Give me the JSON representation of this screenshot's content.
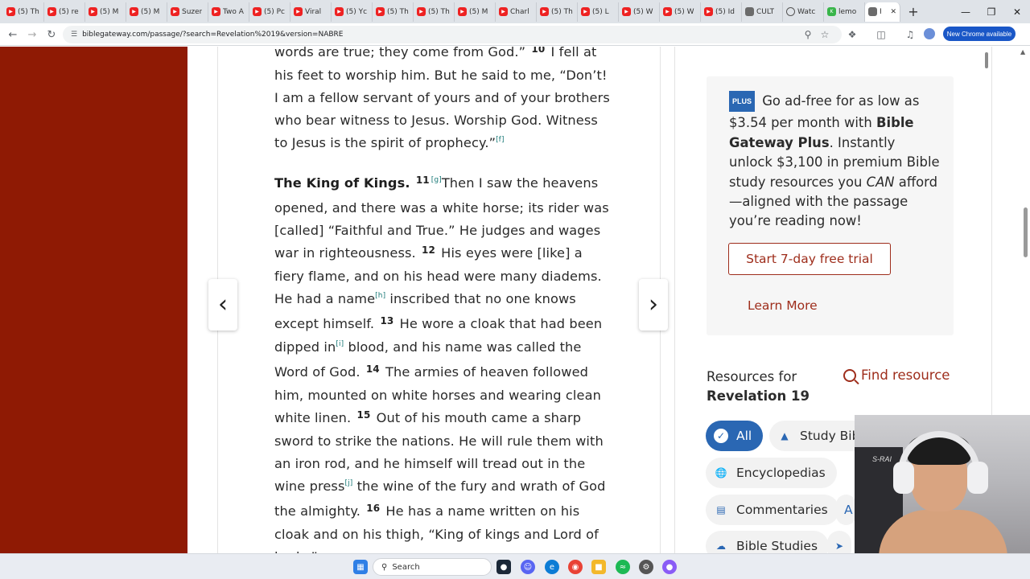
{
  "browser": {
    "tabs": [
      {
        "label": "(5) Th",
        "icon": "youtube-icon"
      },
      {
        "label": "(5) re",
        "icon": "youtube-icon"
      },
      {
        "label": "(5) M",
        "icon": "youtube-icon"
      },
      {
        "label": "(5) M",
        "icon": "youtube-icon"
      },
      {
        "label": "Suzer",
        "icon": "youtube-icon"
      },
      {
        "label": "Two A",
        "icon": "youtube-icon"
      },
      {
        "label": "(5) Pc",
        "icon": "youtube-icon"
      },
      {
        "label": "Viral",
        "icon": "youtube-icon"
      },
      {
        "label": "(5) Yc",
        "icon": "youtube-icon"
      },
      {
        "label": "(5) Th",
        "icon": "youtube-icon"
      },
      {
        "label": "(5) Th",
        "icon": "youtube-icon"
      },
      {
        "label": "(5) M",
        "icon": "youtube-icon"
      },
      {
        "label": "Charl",
        "icon": "youtube-icon"
      },
      {
        "label": "(5) Th",
        "icon": "youtube-icon"
      },
      {
        "label": "(5) L",
        "icon": "youtube-icon"
      },
      {
        "label": "(5) W",
        "icon": "youtube-icon"
      },
      {
        "label": "(5) W",
        "icon": "youtube-icon"
      },
      {
        "label": "(5) Id",
        "icon": "youtube-icon"
      },
      {
        "label": "CULT",
        "icon": "document-icon"
      },
      {
        "label": "Watc",
        "icon": "globe-icon"
      },
      {
        "label": "lemo",
        "icon": "k-icon"
      },
      {
        "label": "R",
        "icon": "document-icon",
        "active": true
      }
    ],
    "new_tab": "+",
    "url": "biblegateway.com/passage/?search=Revelation%2019&version=NABRE",
    "chrome_pill": "New Chrome available"
  },
  "passage": {
    "p1": {
      "t1": "words are true; they come from God.” ",
      "v10": "10",
      "t2": " I fell at his feet to worship him. But he said to me, “Don’t! I am a fellow servant of yours and of your brothers who bear witness to Jesus. Worship God. Witness to Jesus is the spirit of prophecy.”",
      "fn_f": "[f]"
    },
    "p2": {
      "heading": "The King of Kings.",
      "v11": "11",
      "fn_g": "[g]",
      "t1": "Then I saw the heavens opened, and there was a white horse; its rider was [called] “Faithful and True.” He judges and wages war in righteousness. ",
      "v12": "12",
      "t2": " His eyes were [like] a fiery flame, and on his head were many diadems. He had a name",
      "fn_h": "[h]",
      "t3": " inscribed that no one knows except himself. ",
      "v13": "13",
      "t4": " He wore a cloak that had been dipped in",
      "fn_i": "[i]",
      "t5": " blood, and his name was called the Word of God. ",
      "v14": "14",
      "t6": " The armies of heaven followed him, mounted on white horses and wearing clean white linen. ",
      "v15": "15",
      "t7": " Out of his mouth came a sharp sword to strike the nations. He will rule them with an iron rod, and he himself will tread out in the wine press",
      "fn_j": "[j]",
      "t8": " the wine of the fury and wrath of God the almighty. ",
      "v16": "16",
      "t9": " He has a name written on his cloak and on his thigh, “King of kings and Lord of lords.”"
    },
    "prev_arrow": "‹",
    "next_arrow": "›"
  },
  "sidebar": {
    "plus_badge": "PLUS",
    "plus_t1": " Go ad-free for as low as $3.54 per month with ",
    "plus_brand": "Bible Gateway Plus",
    "plus_t2": ". Instantly unlock $3,100 in premium Bible study resources you ",
    "plus_can": "CAN",
    "plus_t3": " afford—aligned with the passage you’re reading now!",
    "trial_button": "Start 7-day free trial",
    "learn_more": "Learn More",
    "resources_label": "Resources for",
    "resources_book": "Revelation 19",
    "find_resource": "Find resource",
    "chips": {
      "all": "All",
      "study_bibles": "Study Bibl",
      "encyclopedias": "Encyclopedias",
      "commentaries": "Commentaries",
      "a": "A",
      "bible_studies": "Bible Studies"
    }
  },
  "webcam": {
    "chair_label": "S-RAI"
  },
  "taskbar": {
    "search_label": "Search"
  },
  "colors": {
    "brand_red": "#8f1a04",
    "link_red": "#9e2d1b",
    "accent_blue": "#2a67b3",
    "footnote_teal": "#1b7a78"
  }
}
